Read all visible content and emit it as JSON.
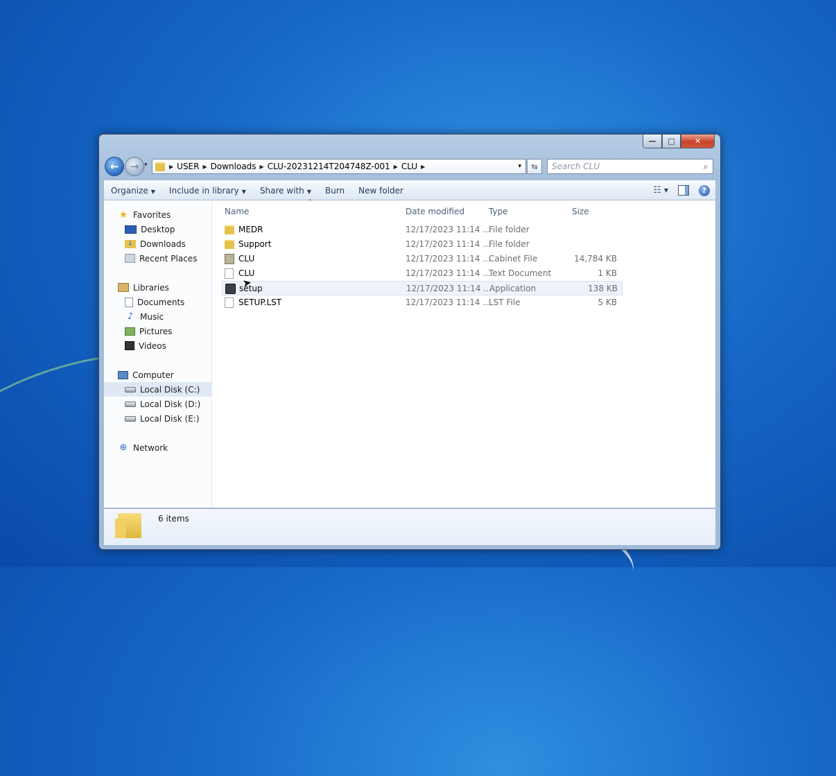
{
  "window": {
    "caption": {
      "minimize": "—",
      "maximize": "□",
      "close": "✕"
    }
  },
  "nav": {
    "back": "←",
    "forward": "→",
    "history_drop": "▾",
    "breadcrumb": [
      "USER",
      "Downloads",
      "CLU-20231214T204748Z-001",
      "CLU"
    ],
    "address_drop": "▾",
    "refresh": "⇆",
    "search_placeholder": "Search CLU"
  },
  "toolbar": {
    "organize": "Organize",
    "include_in_library": "Include in library",
    "share_with": "Share with",
    "burn": "Burn",
    "new_folder": "New folder",
    "dropdown_arrow": "▼",
    "views_icon": "☷",
    "help": "?"
  },
  "sidebar": {
    "favorites": {
      "label": "Favorites",
      "icon": "star-icon",
      "items": [
        {
          "label": "Desktop",
          "icon": "desktop-icon"
        },
        {
          "label": "Downloads",
          "icon": "downloads-icon"
        },
        {
          "label": "Recent Places",
          "icon": "recent-places-icon"
        }
      ]
    },
    "libraries": {
      "label": "Libraries",
      "icon": "library-icon",
      "items": [
        {
          "label": "Documents",
          "icon": "documents-icon"
        },
        {
          "label": "Music",
          "icon": "music-icon"
        },
        {
          "label": "Pictures",
          "icon": "pictures-icon"
        },
        {
          "label": "Videos",
          "icon": "videos-icon"
        }
      ]
    },
    "computer": {
      "label": "Computer",
      "icon": "computer-icon",
      "items": [
        {
          "label": "Local Disk (C:)",
          "icon": "disk-icon",
          "selected": true
        },
        {
          "label": "Local Disk (D:)",
          "icon": "disk-icon"
        },
        {
          "label": "Local Disk (E:)",
          "icon": "disk-icon"
        }
      ]
    },
    "network": {
      "label": "Network",
      "icon": "network-icon"
    }
  },
  "columns": {
    "name": "Name",
    "date": "Date modified",
    "type": "Type",
    "size": "Size",
    "sort_caret": "^"
  },
  "files": [
    {
      "name": "MEDR",
      "date": "12/17/2023 11:14 ...",
      "type": "File folder",
      "size": "",
      "icon": "folder"
    },
    {
      "name": "Support",
      "date": "12/17/2023 11:14 ...",
      "type": "File folder",
      "size": "",
      "icon": "folder"
    },
    {
      "name": "CLU",
      "date": "12/17/2023 11:14 ...",
      "type": "Cabinet File",
      "size": "14,784 KB",
      "icon": "cab"
    },
    {
      "name": "CLU",
      "date": "12/17/2023 11:14 ...",
      "type": "Text Document",
      "size": "1 KB",
      "icon": "txt"
    },
    {
      "name": "setup",
      "date": "12/17/2023 11:14 ...",
      "type": "Application",
      "size": "138 KB",
      "icon": "app",
      "hovered": true
    },
    {
      "name": "SETUP.LST",
      "date": "12/17/2023 11:14 ...",
      "type": "LST File",
      "size": "5 KB",
      "icon": "txt"
    }
  ],
  "details": {
    "count": "6 items"
  },
  "colors": {
    "desktop": "#1667c6",
    "frame": "#a6bfdc",
    "selection": "#dfe8f4"
  }
}
